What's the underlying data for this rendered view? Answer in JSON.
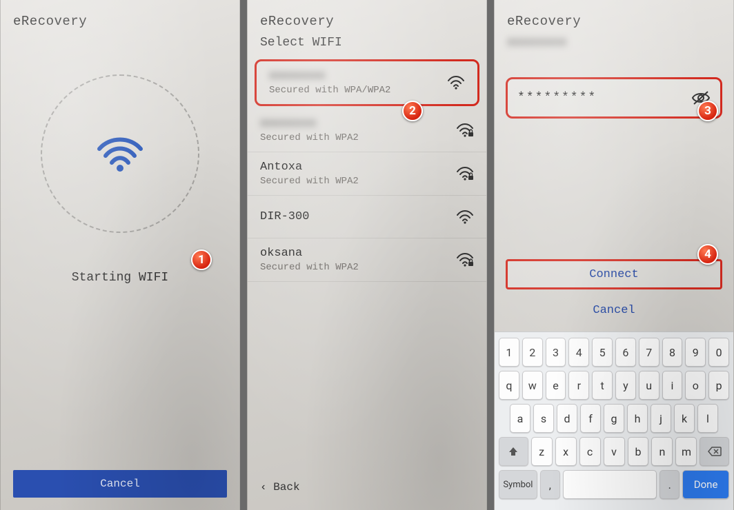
{
  "panel1": {
    "title": "eRecovery",
    "status": "Starting WIFI",
    "cancel": "Cancel",
    "badge": "1"
  },
  "panel2": {
    "title": "eRecovery",
    "subtitle": "Select WIFI",
    "badge": "2",
    "back": "‹  Back",
    "items": [
      {
        "name": "xxxxxxxx",
        "security": "Secured with WPA/WPA2",
        "blurred": true,
        "locked": false,
        "highlight": true
      },
      {
        "name": "xxxxxxxx",
        "security": "Secured with WPA2",
        "blurred": true,
        "locked": true,
        "highlight": false
      },
      {
        "name": "Antoxa",
        "security": "Secured with WPA2",
        "blurred": false,
        "locked": true,
        "highlight": false
      },
      {
        "name": "DIR-300",
        "security": "",
        "blurred": false,
        "locked": false,
        "highlight": false
      },
      {
        "name": "oksana",
        "security": "Secured with WPA2",
        "blurred": false,
        "locked": true,
        "highlight": false
      }
    ]
  },
  "panel3": {
    "title": "eRecovery",
    "blurred_network": "xxxxxxxx",
    "password_masked": "*********",
    "connect": "Connect",
    "cancel": "Cancel",
    "badge_pw": "3",
    "badge_connect": "4",
    "keyboard": {
      "row1": [
        "1",
        "2",
        "3",
        "4",
        "5",
        "6",
        "7",
        "8",
        "9",
        "0"
      ],
      "row2": [
        "q",
        "w",
        "e",
        "r",
        "t",
        "y",
        "u",
        "i",
        "o",
        "p"
      ],
      "row3": [
        "a",
        "s",
        "d",
        "f",
        "g",
        "h",
        "j",
        "k",
        "l"
      ],
      "row4_letters": [
        "z",
        "x",
        "c",
        "v",
        "b",
        "n",
        "m"
      ],
      "symbol": "Symbol",
      "done": "Done"
    }
  }
}
